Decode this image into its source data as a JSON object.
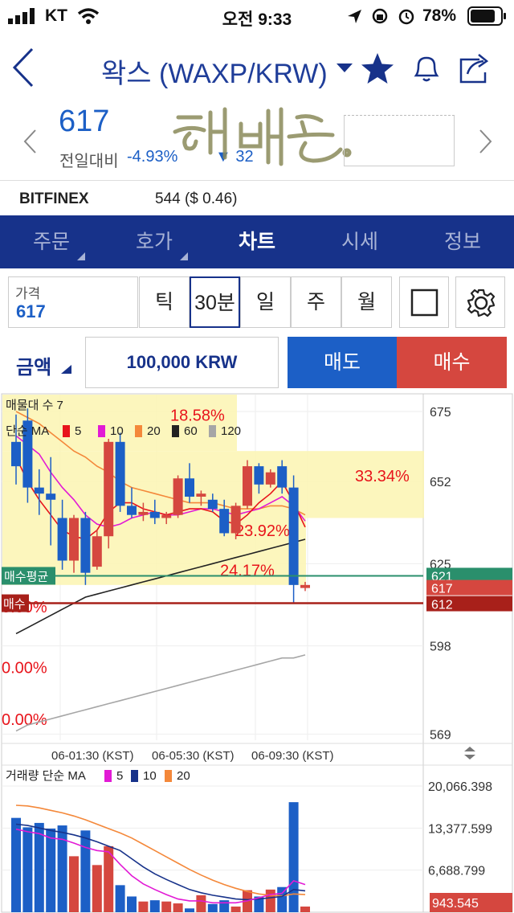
{
  "status": {
    "carrier": "KT",
    "time": "오전 9:33",
    "battery": "78%"
  },
  "nav": {
    "title": "왁스 (WAXP/KRW)"
  },
  "ticker": {
    "price": "617",
    "diff_label": "전일대비",
    "diff_pct": "-4.93%",
    "diff_val": "▼ 32",
    "exchange_name": "BITFINEX",
    "exchange_value": "544 ($ 0.46)"
  },
  "tabs": [
    {
      "label": "주문"
    },
    {
      "label": "호가"
    },
    {
      "label": "차트"
    },
    {
      "label": "시세"
    },
    {
      "label": "정보"
    }
  ],
  "controls": {
    "price_label": "가격",
    "price_value": "617",
    "intervals": [
      "틱",
      "30분",
      "일",
      "주",
      "월"
    ],
    "selected_interval": "30분",
    "amount_label": "금액",
    "amount_value": "100,000 KRW",
    "sell_label": "매도",
    "buy_label": "매수"
  },
  "colors": {
    "up": "#d5473f",
    "down": "#1c5fc6",
    "navy": "#17328a",
    "green": "#2a8f6c"
  },
  "chart_data": [
    {
      "type": "candlestick",
      "title": "매물대 수 7",
      "legend": {
        "label": "단순 MA",
        "periods": [
          "5",
          "10",
          "20",
          "60",
          "120"
        ],
        "colors": [
          "#e8141b",
          "#e21ad5",
          "#f4883a",
          "#222222",
          "#a6a6a6"
        ]
      },
      "y_ticks": [
        "675",
        "652",
        "625",
        "598",
        "569"
      ],
      "ylim": [
        567,
        680
      ],
      "x_ticks": [
        "06-01:30 (KST)",
        "06-05:30 (KST)",
        "06-09:30 (KST)"
      ],
      "volume_profile_pct": [
        "18.58%",
        "33.34%",
        "23.92%",
        "24.17%",
        "0.00%",
        "0.00%",
        "0.00%"
      ],
      "avg_buy": {
        "label": "매수평균",
        "value": "621"
      },
      "current": {
        "value": "617"
      },
      "buy_line": {
        "label": "매수",
        "value": "612"
      },
      "candles": [
        {
          "o": 665,
          "h": 674,
          "l": 651,
          "c": 657,
          "dir": "down"
        },
        {
          "o": 672,
          "h": 676,
          "l": 645,
          "c": 650,
          "dir": "down"
        },
        {
          "o": 650,
          "h": 656,
          "l": 641,
          "c": 648,
          "dir": "down"
        },
        {
          "o": 648,
          "h": 660,
          "l": 631,
          "c": 646,
          "dir": "down"
        },
        {
          "o": 640,
          "h": 646,
          "l": 623,
          "c": 626,
          "dir": "down"
        },
        {
          "o": 626,
          "h": 641,
          "l": 622,
          "c": 640,
          "dir": "up"
        },
        {
          "o": 640,
          "h": 642,
          "l": 618,
          "c": 622,
          "dir": "down"
        },
        {
          "o": 624,
          "h": 636,
          "l": 623,
          "c": 634,
          "dir": "up"
        },
        {
          "o": 634,
          "h": 666,
          "l": 630,
          "c": 665,
          "dir": "up"
        },
        {
          "o": 665,
          "h": 668,
          "l": 642,
          "c": 644,
          "dir": "down"
        },
        {
          "o": 644,
          "h": 650,
          "l": 640,
          "c": 641,
          "dir": "down"
        },
        {
          "o": 641,
          "h": 645,
          "l": 639,
          "c": 642,
          "dir": "up"
        },
        {
          "o": 642,
          "h": 646,
          "l": 638,
          "c": 640,
          "dir": "down"
        },
        {
          "o": 640,
          "h": 642,
          "l": 638,
          "c": 641,
          "dir": "up"
        },
        {
          "o": 641,
          "h": 654,
          "l": 640,
          "c": 653,
          "dir": "up"
        },
        {
          "o": 653,
          "h": 658,
          "l": 645,
          "c": 647,
          "dir": "down"
        },
        {
          "o": 647,
          "h": 649,
          "l": 644,
          "c": 648,
          "dir": "up"
        },
        {
          "o": 646,
          "h": 648,
          "l": 642,
          "c": 643,
          "dir": "down"
        },
        {
          "o": 643,
          "h": 646,
          "l": 634,
          "c": 635,
          "dir": "down"
        },
        {
          "o": 635,
          "h": 645,
          "l": 633,
          "c": 644,
          "dir": "up"
        },
        {
          "o": 644,
          "h": 659,
          "l": 643,
          "c": 657,
          "dir": "up"
        },
        {
          "o": 657,
          "h": 658,
          "l": 648,
          "c": 651,
          "dir": "down"
        },
        {
          "o": 651,
          "h": 656,
          "l": 650,
          "c": 655,
          "dir": "up"
        },
        {
          "o": 657,
          "h": 659,
          "l": 648,
          "c": 650,
          "dir": "down"
        },
        {
          "o": 650,
          "h": 654,
          "l": 612,
          "c": 618,
          "dir": "down"
        },
        {
          "o": 618,
          "h": 619,
          "l": 616,
          "c": 617,
          "dir": "up"
        }
      ],
      "ma": {
        "ma5": [
          660,
          652,
          646,
          641,
          636,
          634,
          633,
          636,
          642,
          645,
          645,
          643,
          642,
          641,
          642,
          643,
          643,
          642,
          639,
          638,
          641,
          645,
          648,
          652,
          645,
          637
        ],
        "ma10": [
          667,
          664,
          661,
          655,
          650,
          646,
          641,
          638,
          637,
          638,
          640,
          641,
          642,
          641,
          641,
          642,
          643,
          643,
          642,
          641,
          642,
          643,
          645,
          647,
          644,
          639
        ],
        "ma20": [
          675,
          673,
          671,
          668,
          665,
          662,
          660,
          657,
          655,
          652,
          650,
          649,
          648,
          647,
          646,
          645,
          645,
          645,
          644,
          643,
          643,
          643,
          644,
          644,
          643,
          641
        ],
        "ma60": [
          602,
          604,
          606,
          608,
          610,
          612,
          614,
          615,
          616,
          617,
          618,
          619,
          620,
          621,
          622,
          623,
          624,
          625,
          626,
          627,
          628,
          629,
          630,
          631,
          632,
          633
        ],
        "ma120": [
          570,
          572,
          573,
          574,
          575,
          576,
          577,
          578,
          579,
          580,
          581,
          582,
          583,
          584,
          585,
          586,
          587,
          588,
          589,
          590,
          591,
          592,
          593,
          594,
          594,
          595
        ]
      }
    },
    {
      "type": "bar",
      "title": "거래량 단순 MA",
      "legend": {
        "periods": [
          "5",
          "10",
          "20"
        ],
        "colors": [
          "#e21ad5",
          "#17328a",
          "#f4883a"
        ]
      },
      "y_ticks": [
        "20,066.398",
        "13,377.599",
        "6,688.799"
      ],
      "current_value": "943.545",
      "ylim": [
        0,
        22500
      ],
      "values": [
        15000,
        13500,
        14200,
        13300,
        13800,
        8900,
        13000,
        7500,
        10500,
        4300,
        2500,
        1700,
        1900,
        1700,
        1400,
        600,
        2700,
        1300,
        1900,
        900,
        3500,
        2500,
        3600,
        4000,
        17500,
        900
      ],
      "dirs": [
        "down",
        "down",
        "down",
        "down",
        "down",
        "up",
        "down",
        "up",
        "up",
        "down",
        "down",
        "up",
        "down",
        "up",
        "up",
        "down",
        "up",
        "down",
        "down",
        "up",
        "up",
        "down",
        "up",
        "down",
        "down",
        "up"
      ],
      "ma5": [
        13200,
        12800,
        12500,
        11800,
        11600,
        11000,
        10300,
        9800,
        9600,
        7600,
        5800,
        4500,
        3600,
        2800,
        2100,
        1800,
        1800,
        1500,
        1500,
        1500,
        1800,
        2300,
        2800,
        3000,
        5000,
        4400
      ],
      "ma10": [
        14000,
        13800,
        13400,
        13000,
        12700,
        12300,
        11800,
        11200,
        10500,
        9800,
        8500,
        7200,
        6100,
        5200,
        4400,
        3600,
        3100,
        2700,
        2400,
        2100,
        2000,
        2100,
        2300,
        2500,
        3600,
        3400
      ],
      "ma20": [
        17000,
        16900,
        16600,
        16200,
        15800,
        15300,
        14700,
        14000,
        13300,
        12600,
        11800,
        10800,
        9800,
        8800,
        7800,
        6800,
        5900,
        5100,
        4400,
        3800,
        3300,
        2900,
        2700,
        2600,
        2900,
        2800
      ]
    }
  ]
}
